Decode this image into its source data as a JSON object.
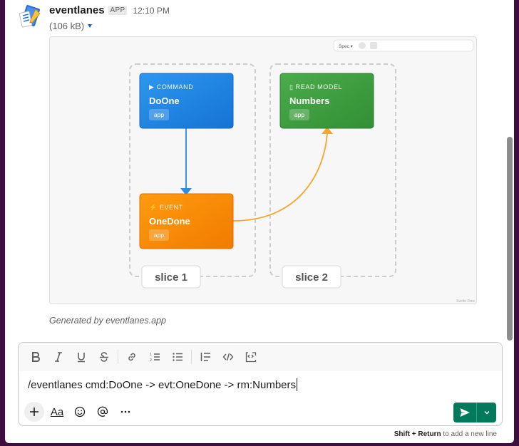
{
  "message": {
    "author": "eventlanes",
    "badge": "APP",
    "time": "12:10 PM",
    "file_size": "(106 kB)",
    "caption": "Generated by eventlanes.app"
  },
  "diagram": {
    "toolbar": {
      "dropdown_label": "Spec ▾"
    },
    "watermark": "Svelte Flow",
    "slices": [
      {
        "label": "slice 1"
      },
      {
        "label": "slice 2"
      }
    ],
    "nodes": [
      {
        "kind_label": "▶ COMMAND",
        "name": "DoOne",
        "tag": "app",
        "color": "#1f86e0"
      },
      {
        "kind_label": "⚡ EVENT",
        "name": "OneDone",
        "tag": "app",
        "color": "#f78a00"
      },
      {
        "kind_label": "▯ READ MODEL",
        "name": "Numbers",
        "tag": "app",
        "color": "#3c9b3e"
      }
    ]
  },
  "composer": {
    "input_value": "/eventlanes cmd:DoOne -> evt:OneDone -> rm:Numbers",
    "toolbar_icons": [
      "bold-icon",
      "italic-icon",
      "underline-icon",
      "strikethrough-icon",
      "link-icon",
      "ordered-list-icon",
      "bulleted-list-icon",
      "blockquote-icon",
      "code-icon",
      "code-block-icon"
    ],
    "format_label": "Aa",
    "hint_key": "Shift + Return",
    "hint_text": " to add a new line"
  },
  "colors": {
    "send": "#007a5a",
    "link": "#1264a3",
    "sidebar": "#3f0e40"
  }
}
